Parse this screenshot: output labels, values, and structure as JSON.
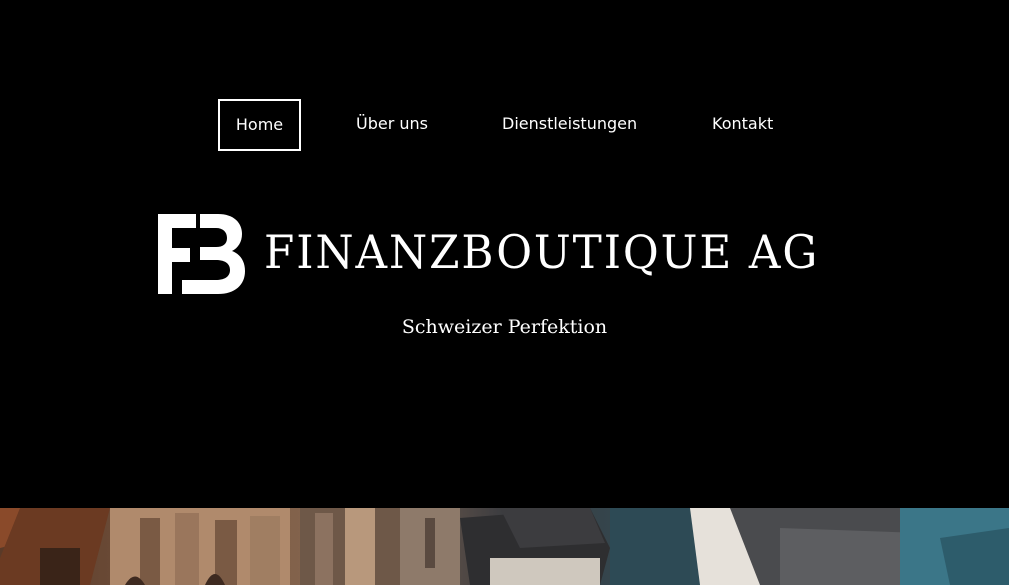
{
  "nav": {
    "items": [
      {
        "label": "Home",
        "active": true
      },
      {
        "label": "Über uns",
        "active": false
      },
      {
        "label": "Dienstleistungen",
        "active": false
      },
      {
        "label": "Kontakt",
        "active": false
      }
    ]
  },
  "brand": {
    "logo_letters": "FB",
    "name": "FINANZBOUTIQUE AG",
    "tagline": "Schweizer Perfektion"
  },
  "hero": {
    "description_icon": "city-rooftops-photo"
  },
  "colors": {
    "background": "#000000",
    "text": "#ffffff"
  }
}
